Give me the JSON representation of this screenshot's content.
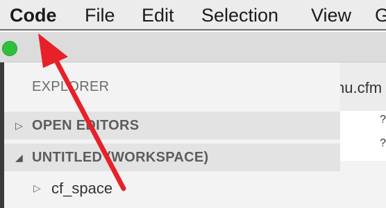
{
  "menubar": {
    "app_menu": "Code",
    "file": "File",
    "edit": "Edit",
    "selection": "Selection",
    "view": "View",
    "cut_off": "G"
  },
  "window": {
    "traffic_light_color": "#2fbf3c"
  },
  "sidebar": {
    "title": "EXPLORER",
    "sections": {
      "open_editors": {
        "label": "OPEN EDITORS",
        "twisty": "▷"
      },
      "workspace": {
        "label": "UNTITLED (WORKSPACE)",
        "twisty": "◢"
      }
    },
    "folder": {
      "label": "cf_space",
      "twisty": "▷"
    }
  },
  "editor": {
    "tab_text": "nu.cfm",
    "edge_glyph_top": "?",
    "edge_glyph_bottom": "?"
  },
  "annotation": {
    "color": "#e8202a"
  }
}
